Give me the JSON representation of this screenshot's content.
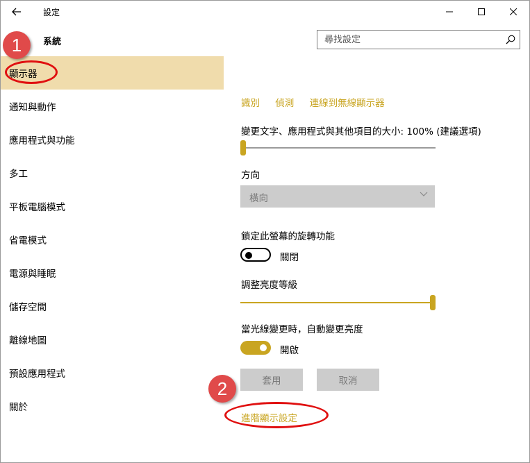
{
  "window": {
    "title": "設定",
    "colors": {
      "accent": "#c9a521",
      "selected_bg": "#f0dcac",
      "annotation": "#e04a4a"
    }
  },
  "sidebar": {
    "header": "系統",
    "items": [
      {
        "label": "顯示器",
        "active": true
      },
      {
        "label": "通知與動作"
      },
      {
        "label": "應用程式與功能"
      },
      {
        "label": "多工"
      },
      {
        "label": "平板電腦模式"
      },
      {
        "label": "省電模式"
      },
      {
        "label": "電源與睡眠"
      },
      {
        "label": "儲存空間"
      },
      {
        "label": "離線地圖"
      },
      {
        "label": "預設應用程式"
      },
      {
        "label": "關於"
      }
    ]
  },
  "search": {
    "placeholder": "尋找設定",
    "icon": "search-icon"
  },
  "annotations": {
    "marker_1": "1",
    "marker_2": "2"
  },
  "display": {
    "links": {
      "identify": "識別",
      "detect": "偵測",
      "wireless": "連線到無線顯示器"
    },
    "scale": {
      "label": "變更文字、應用程式與其他項目的大小: 100% (建議選項)",
      "value_fraction": 0.0
    },
    "orientation": {
      "label": "方向",
      "value": "橫向"
    },
    "rotation_lock": {
      "label": "鎖定此螢幕的旋轉功能",
      "state_text": "關閉",
      "on": false
    },
    "brightness": {
      "label": "調整亮度等級",
      "value_fraction": 1.0
    },
    "auto_brightness": {
      "label": "當光線變更時，自動變更亮度",
      "state_text": "開啟",
      "on": true
    },
    "buttons": {
      "apply": "套用",
      "cancel": "取消"
    },
    "advanced_link": "進階顯示設定"
  }
}
